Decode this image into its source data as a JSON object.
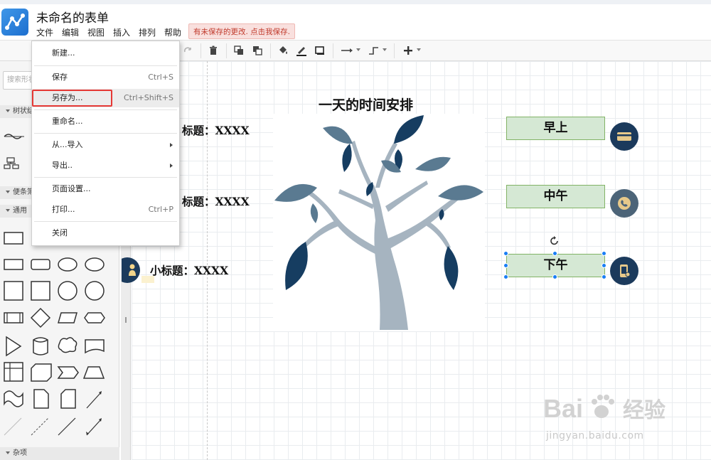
{
  "app": {
    "doc_title": "未命名的表单",
    "menubar": [
      "文件",
      "编辑",
      "视图",
      "插入",
      "排列",
      "帮助"
    ],
    "unsaved_notice": "有未保存的更改. 点击我保存."
  },
  "sidebar": {
    "search_placeholder": "搜索形状",
    "sections": {
      "tree": "树状结构",
      "notes": "便条簿",
      "general": "通用",
      "misc": "杂项"
    }
  },
  "file_menu": {
    "new": "新建...",
    "save": {
      "label": "保存",
      "shortcut": "Ctrl+S"
    },
    "save_as": {
      "label": "另存为...",
      "shortcut": "Ctrl+Shift+S"
    },
    "rename": "重命名...",
    "import_from": "从...导入",
    "export": "导出..",
    "page_setup": "页面设置...",
    "print": {
      "label": "打印...",
      "shortcut": "Ctrl+P"
    },
    "close": "关闭"
  },
  "canvas": {
    "title": "一天的时间安排",
    "subtitles": [
      "标题：XXXX",
      "标题：XXXX",
      "小标题：XXXX"
    ],
    "time_blocks": [
      "早上",
      "中午",
      "下午"
    ]
  },
  "colors": {
    "accent_blue": "#1a7ef5",
    "box_fill": "#d5e8d4",
    "box_border": "#82b366",
    "icon_dark": "#1b3a5c",
    "leaf_dark": "#163d61",
    "leaf_mid": "#5a7a91",
    "trunk": "#a6b4c0",
    "highlight_red": "#e53935"
  },
  "watermark": {
    "brand": "Bai 经验",
    "url": "jingyan.baidu.com"
  }
}
